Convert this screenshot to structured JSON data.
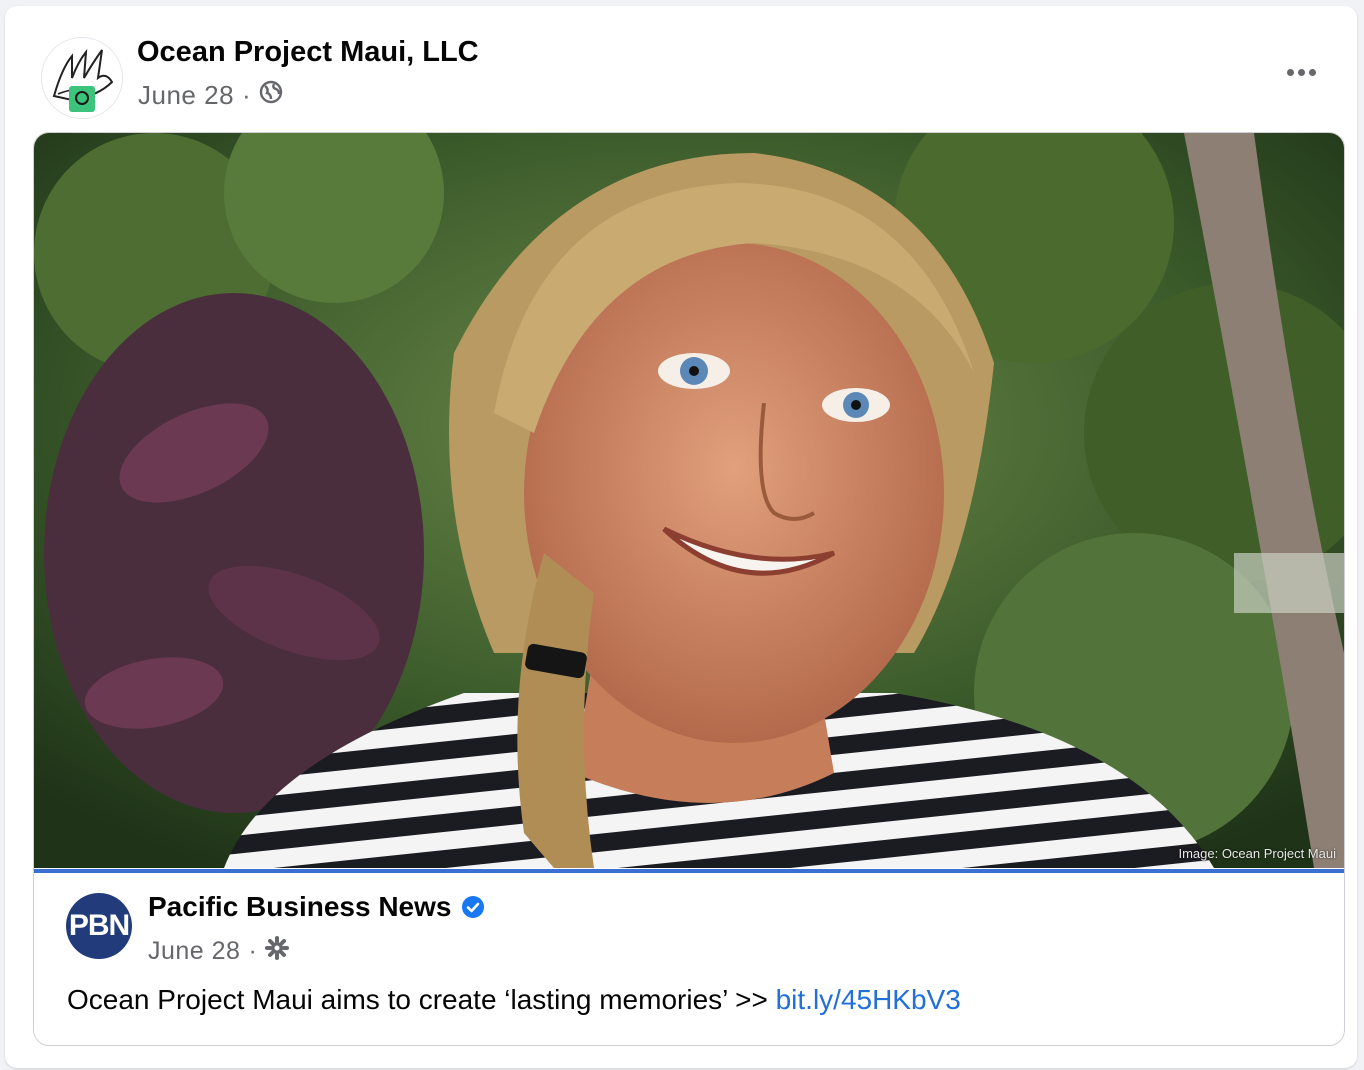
{
  "post": {
    "author": "Ocean Project Maui, LLC",
    "date": "June 28",
    "separator": "·",
    "privacy_icon": "globe-icon",
    "more_icon": "more-horizontal-icon"
  },
  "shared_post": {
    "photo_credit": "Image: Ocean Project Maui",
    "author": "Pacific Business News",
    "logo_text": "PBN",
    "verified_icon": "verified-badge-icon",
    "date": "June 28",
    "separator": "·",
    "audience_icon": "gear-icon",
    "text": "Ocean Project Maui aims to create ‘lasting memories’ >>",
    "link_text": "bit.ly/45HKbV3"
  },
  "colors": {
    "link": "#216fdb",
    "meta_text": "#65676b",
    "pbn_logo_bg": "#223b7a",
    "accent_rule": "#3b6fd1"
  }
}
